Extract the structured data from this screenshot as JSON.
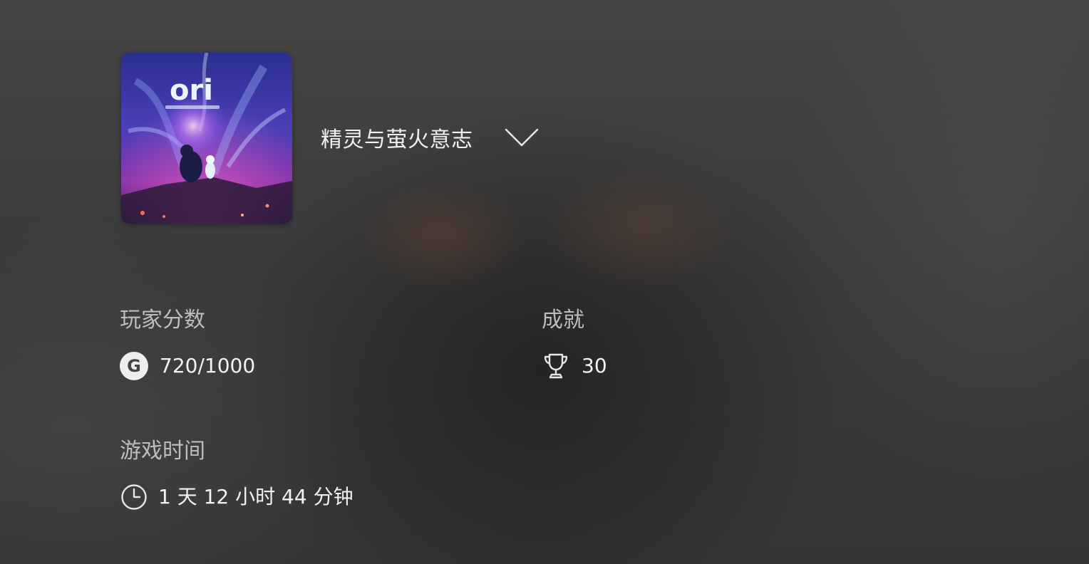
{
  "game": {
    "title": "精灵与萤火意志",
    "cover_icon": "game-cover-art",
    "cover_logo": "ori",
    "expand_icon": "chevron-down-icon"
  },
  "stats": {
    "gamerscore": {
      "label": "玩家分数",
      "icon": "gamerscore-g-icon",
      "value": "720/1000"
    },
    "achievements": {
      "label": "成就",
      "icon": "trophy-icon",
      "value": "30"
    },
    "playtime": {
      "label": "游戏时间",
      "icon": "clock-icon",
      "value": "1 天 12 小时 44 分钟"
    }
  },
  "colors": {
    "background": "#3c3c3c",
    "text_primary": "#f0f0f0",
    "text_label": "#bdbdbd"
  }
}
